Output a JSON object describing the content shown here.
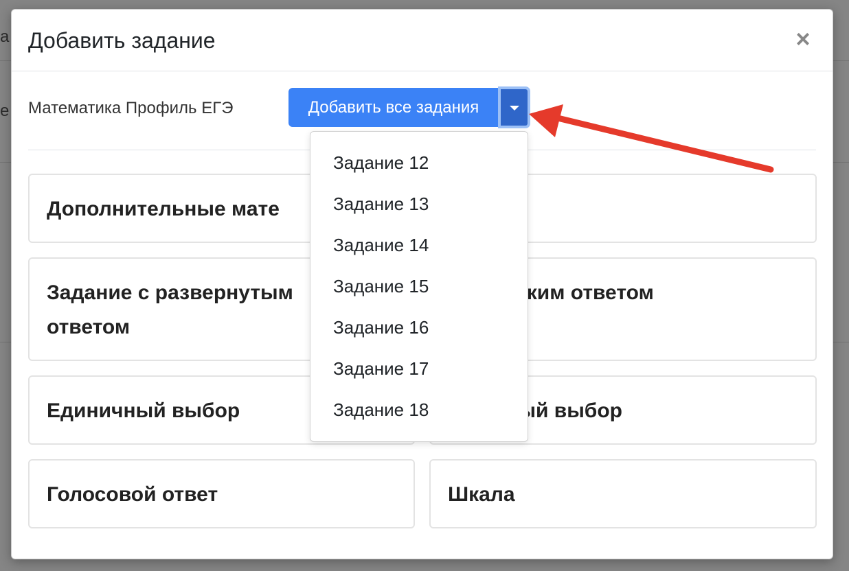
{
  "modal": {
    "title": "Добавить задание",
    "close_symbol": "×"
  },
  "toolbar": {
    "subject": "Математика Профиль ЕГЭ",
    "add_all_label": "Добавить все задания"
  },
  "cards": {
    "additional_materials": "Дополнительные мате",
    "extended_answer_line1": "Задание с развернутым",
    "extended_answer_line2": "ответом",
    "short_answer": "е с кратким ответом",
    "single_choice": "Единичный выбор",
    "multiple_choice": "ственный выбор",
    "voice_answer": "Голосовой ответ",
    "scale": "Шкала"
  },
  "dropdown": {
    "items": [
      "Задание 12",
      "Задание 13",
      "Задание 14",
      "Задание 15",
      "Задание 16",
      "Задание 17",
      "Задание 18"
    ]
  },
  "background": {
    "left_glyph_1": "а",
    "left_glyph_2": "е"
  },
  "colors": {
    "primary": "#3b82f6",
    "primary_dark": "#2f66c9",
    "annotation_arrow": "#e53a2b"
  }
}
